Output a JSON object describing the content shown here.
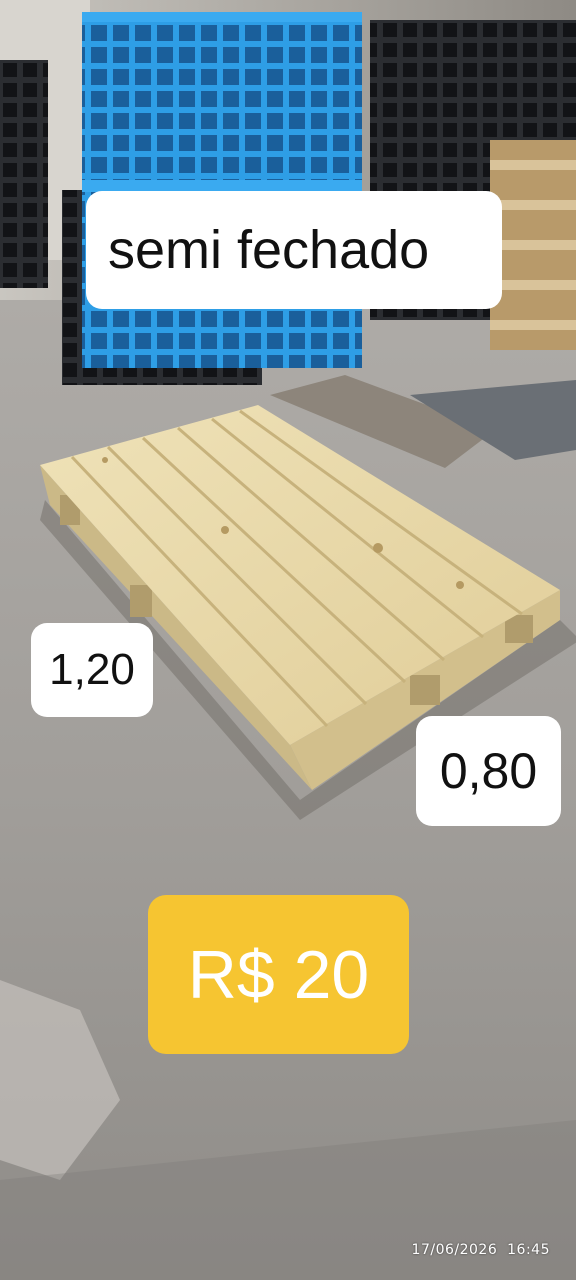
{
  "labels": {
    "title": "semi fechado",
    "length": "1,20",
    "width": "0,80",
    "price": "R$ 20"
  },
  "timestamp": {
    "date": "17/06/2026",
    "time": "16:45"
  },
  "colors": {
    "price_badge": "#f6c531",
    "label_background": "#ffffff",
    "pallet_wood": "#e6d6a6",
    "plastic_pallet_blue": "#2f9fe8",
    "ground_concrete": "#a3a09c"
  },
  "scene": {
    "subject": "wooden-pallet",
    "background_items": [
      "blue-plastic-pallet",
      "black-plastic-pallets",
      "stacked-wooden-pallets"
    ]
  }
}
